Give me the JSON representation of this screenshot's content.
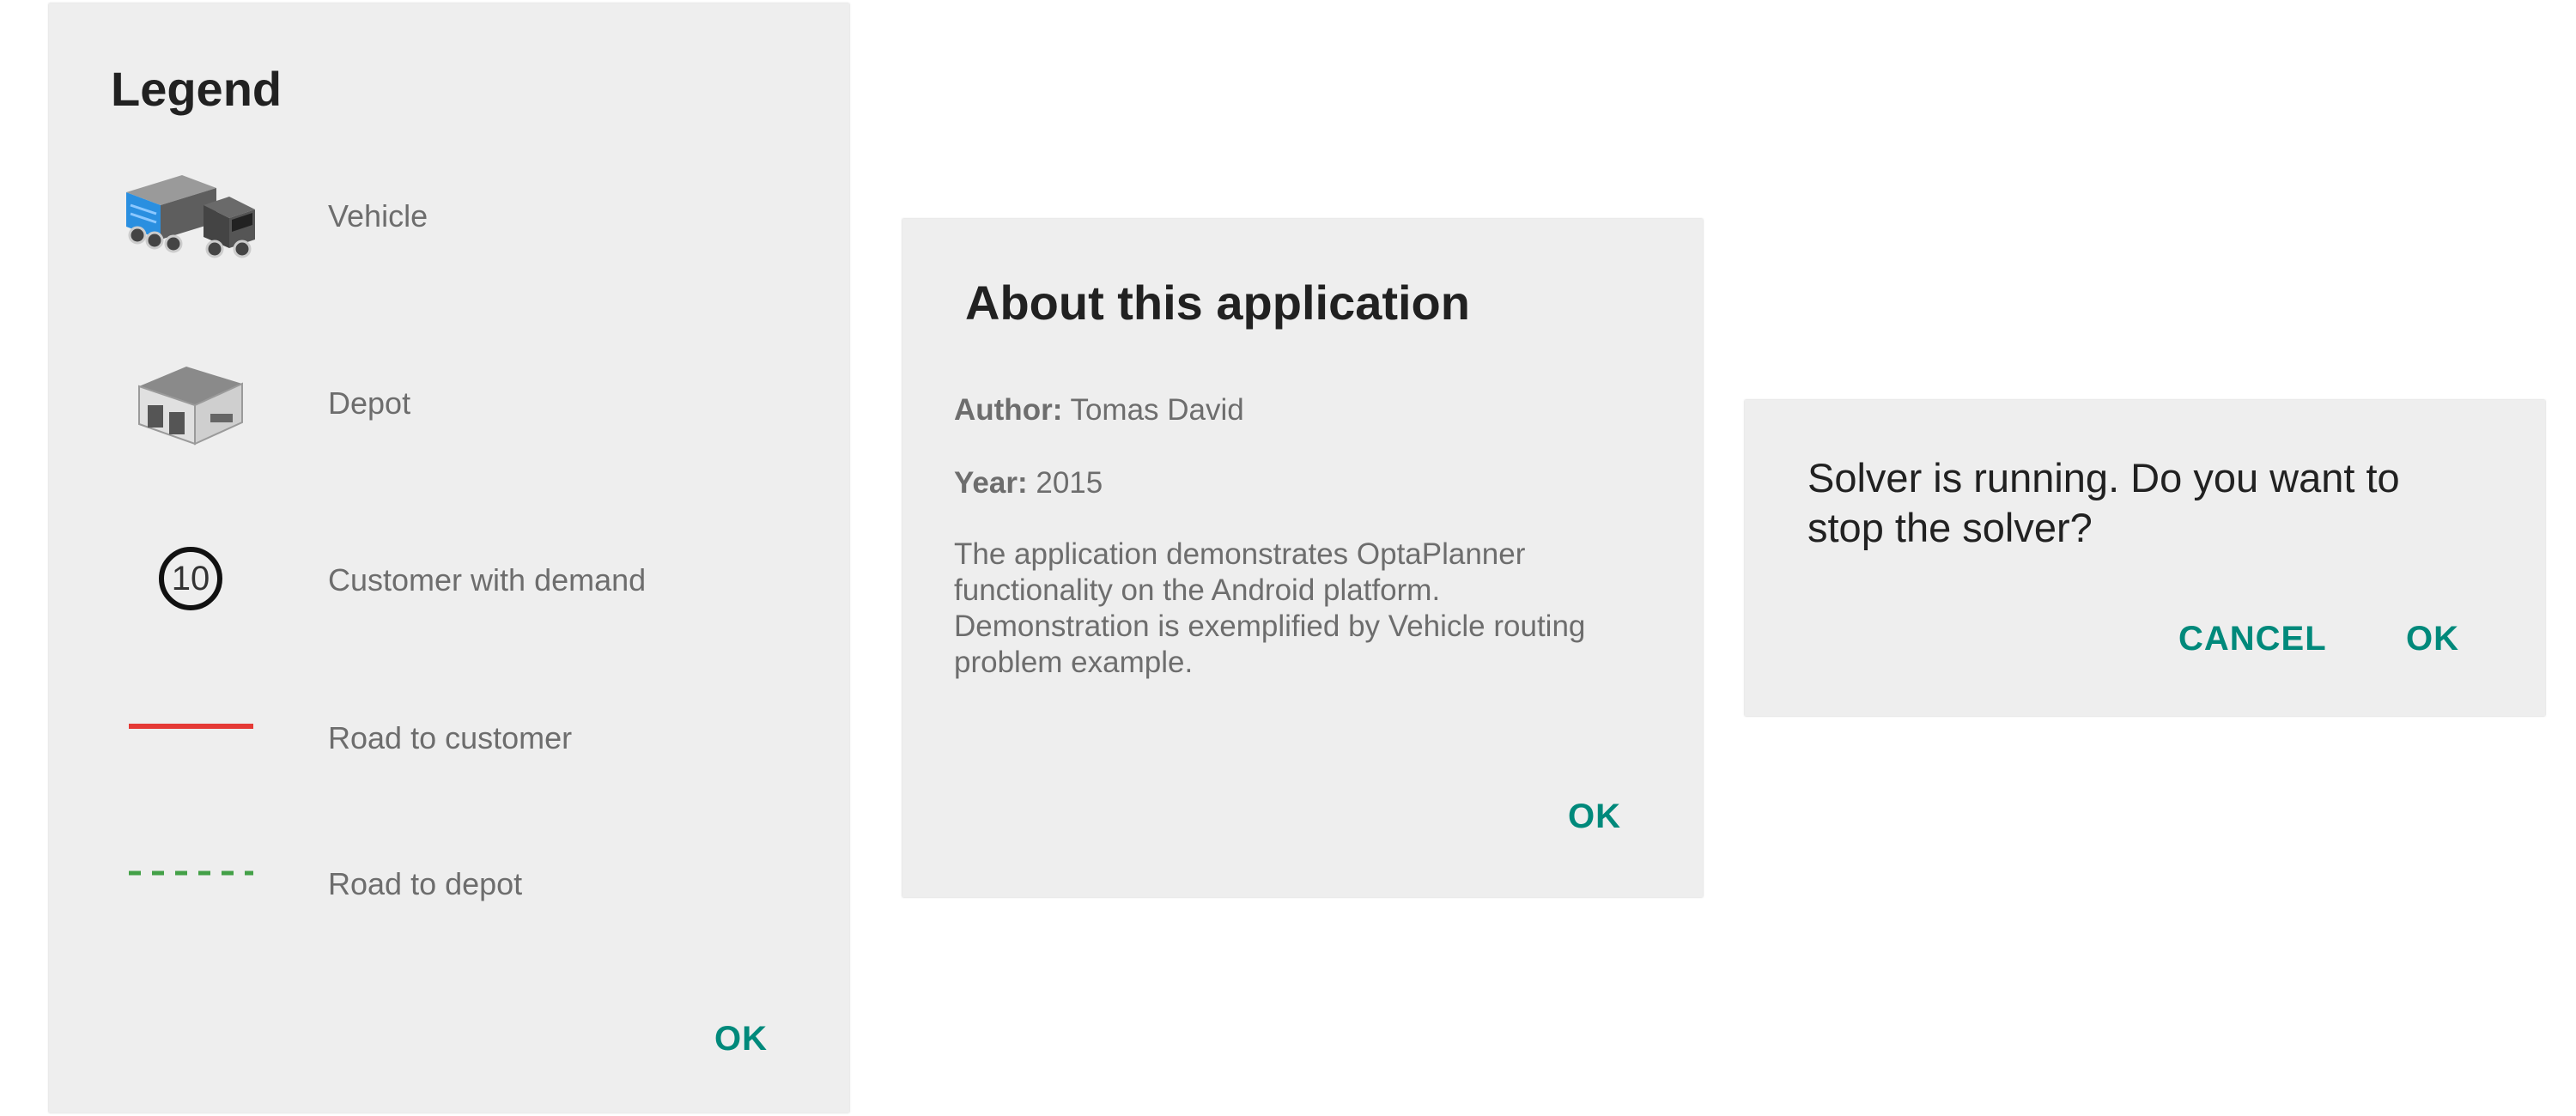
{
  "legend": {
    "title": "Legend",
    "items": [
      {
        "label": "Vehicle",
        "icon": "truck-icon"
      },
      {
        "label": "Depot",
        "icon": "warehouse-icon"
      },
      {
        "label": "Customer with demand",
        "icon": "customer-demand-icon",
        "demand": "10"
      },
      {
        "label": "Road to customer",
        "icon": "red-solid-line-icon",
        "color": "#e53935"
      },
      {
        "label": "Road to depot",
        "icon": "green-dashed-line-icon",
        "color": "#43a047"
      }
    ],
    "ok_label": "OK"
  },
  "about": {
    "title": "About this application",
    "author_label": "Author:",
    "author_value": "Tomas David",
    "year_label": "Year:",
    "year_value": "2015",
    "description": "The application demonstrates OptaPlanner functionality on the Android platform. Demonstration is exemplified by Vehicle routing problem example.",
    "ok_label": "OK"
  },
  "solver_dialog": {
    "message": "Solver is running. Do you want to stop the solver?",
    "cancel_label": "CANCEL",
    "ok_label": "OK"
  },
  "colors": {
    "accent": "#00897b",
    "dialog_bg": "#eeeeee",
    "text_secondary": "#6d6d6d",
    "text_primary": "#212121",
    "truck_blue": "#2a8fe0"
  }
}
